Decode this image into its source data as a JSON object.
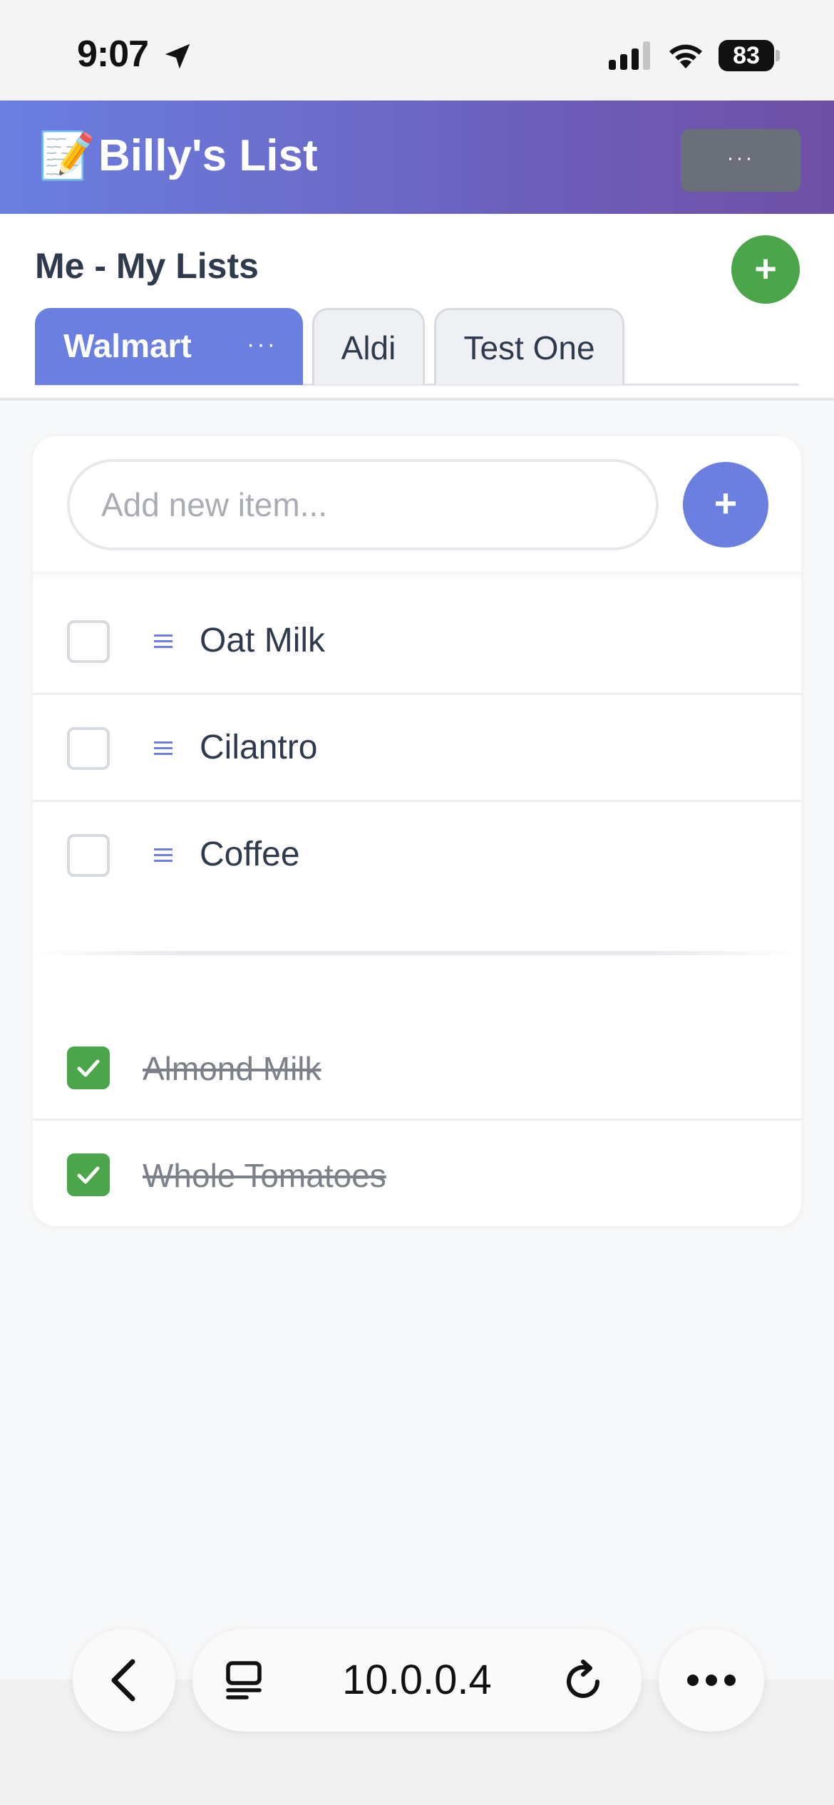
{
  "status_bar": {
    "time": "9:07",
    "battery": "83",
    "icons": [
      "location-arrow-icon",
      "cellular-signal-icon",
      "wifi-icon",
      "battery-icon"
    ]
  },
  "header": {
    "emoji": "📝",
    "title": "Billy's List",
    "menu_label": "···"
  },
  "lists": {
    "title": "Me - My Lists",
    "add_label": "+",
    "tabs": [
      {
        "label": "Walmart",
        "menu": "···",
        "active": true
      },
      {
        "label": "Aldi",
        "active": false
      },
      {
        "label": "Test One",
        "active": false
      }
    ]
  },
  "add_item": {
    "placeholder": "Add new item...",
    "button_label": "+"
  },
  "items": [
    {
      "label": "Oat Milk",
      "checked": false
    },
    {
      "label": "Cilantro",
      "checked": false
    },
    {
      "label": "Coffee",
      "checked": false
    }
  ],
  "completed_items": [
    {
      "label": "Almond Milk",
      "checked": true
    },
    {
      "label": "Whole Tomatoes",
      "checked": true
    }
  ],
  "browser": {
    "url": "10.0.0.4",
    "icons": [
      "back-icon",
      "tabs-icon",
      "reload-icon",
      "more-icon"
    ]
  },
  "colors": {
    "accent": "#6a7fe0",
    "header_end": "#6e4fa5",
    "success": "#4aa54b"
  }
}
